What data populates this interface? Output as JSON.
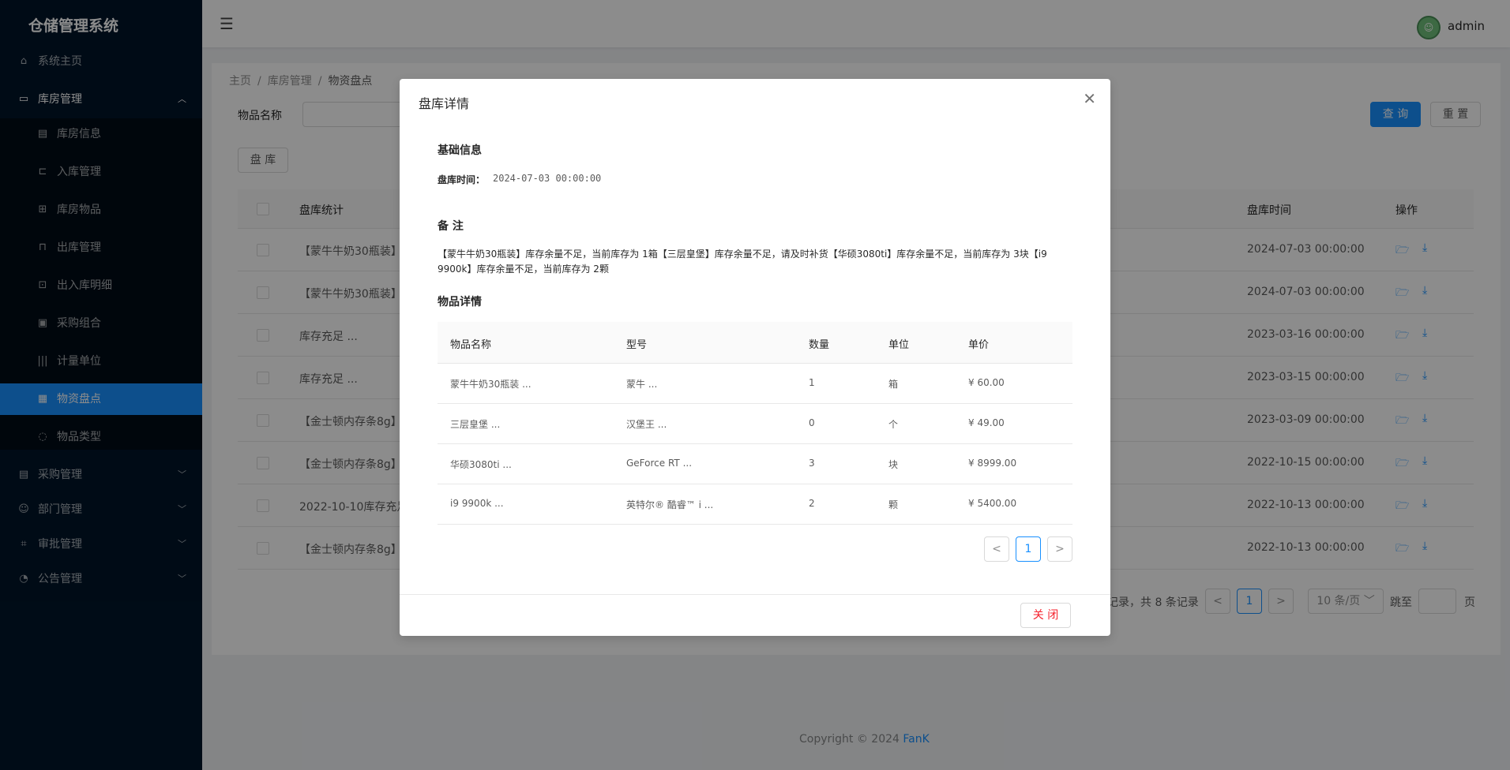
{
  "app": {
    "title": "仓储管理系统"
  },
  "sidebar": {
    "items": [
      {
        "label": "系统主页",
        "icon": "home-icon"
      },
      {
        "label": "库房管理",
        "icon": "warehouse-icon"
      },
      {
        "label": "库房信息",
        "icon": "info-icon"
      },
      {
        "label": "入库管理",
        "icon": "inbound-icon"
      },
      {
        "label": "库房物品",
        "icon": "table-icon"
      },
      {
        "label": "出库管理",
        "icon": "outbound-icon"
      },
      {
        "label": "出入库明细",
        "icon": "detail-icon"
      },
      {
        "label": "采购组合",
        "icon": "bundle-icon"
      },
      {
        "label": "计量单位",
        "icon": "barcode-icon"
      },
      {
        "label": "物资盘点",
        "icon": "inventory-icon"
      },
      {
        "label": "物品类型",
        "icon": "loading-icon"
      },
      {
        "label": "采购管理",
        "icon": "purchase-icon"
      },
      {
        "label": "部门管理",
        "icon": "user-icon"
      },
      {
        "label": "审批管理",
        "icon": "approval-icon"
      },
      {
        "label": "公告管理",
        "icon": "notice-icon"
      }
    ]
  },
  "header": {
    "username": "admin"
  },
  "breadcrumb": {
    "home": "主页",
    "section": "库房管理",
    "current": "物资盘点",
    "sep": "/"
  },
  "search": {
    "label": "物品名称",
    "query_label": "查 询",
    "reset_label": "重 置"
  },
  "toolbar": {
    "inventory_label": "盘 库"
  },
  "table": {
    "headers": {
      "stats": "盘库统计",
      "time": "盘库时间",
      "actions": "操作"
    },
    "rows": [
      {
        "stats": "【蒙牛牛奶30瓶装】",
        "time": "2024-07-03 00:00:00"
      },
      {
        "stats": "【蒙牛牛奶30瓶装】",
        "time": "2024-07-03 00:00:00"
      },
      {
        "stats": "库存充足 ...",
        "time": "2023-03-16 00:00:00"
      },
      {
        "stats": "库存充足 ...",
        "time": "2023-03-15 00:00:00"
      },
      {
        "stats": "【金士顿内存条8g】",
        "time": "2023-03-09 00:00:00"
      },
      {
        "stats": "【金士顿内存条8g】",
        "time": "2022-10-15 00:00:00"
      },
      {
        "stats": "2022-10-10库存充足",
        "time": "2022-10-13 00:00:00"
      },
      {
        "stats": "【金士顿内存条8g】",
        "time": "2022-10-13 00:00:00"
      }
    ]
  },
  "pagination": {
    "summary": "记录，共 8 条记录",
    "current": "1",
    "size": "10 条/页",
    "jump_label": "跳至",
    "page_suffix": "页",
    "prev": "<",
    "next": ">"
  },
  "footer": {
    "copyright": "Copyright © 2024",
    "author": "FanK"
  },
  "modal": {
    "title": "盘库详情",
    "basic_title": "基础信息",
    "time_label": "盘库时间：",
    "time_value": "2024-07-03 00:00:00",
    "remark_title": "备 注",
    "remark": "【蒙牛牛奶30瓶装】库存余量不足，当前库存为 1箱【三层皇堡】库存余量不足，请及时补货【华硕3080ti】库存余量不足，当前库存为 3块【i9 9900k】库存余量不足，当前库存为 2颗",
    "items_title": "物品详情",
    "item_headers": {
      "name": "物品名称",
      "model": "型号",
      "qty": "数量",
      "unit": "单位",
      "price": "单价"
    },
    "items": [
      {
        "name": "蒙牛牛奶30瓶装 ...",
        "model": "蒙牛 ...",
        "qty": "1",
        "unit": "箱",
        "price": "¥ 60.00"
      },
      {
        "name": "三层皇堡 ...",
        "model": "汉堡王 ...",
        "qty": "0",
        "unit": "个",
        "price": "¥ 49.00"
      },
      {
        "name": "华硕3080ti ...",
        "model": "GeForce RT ...",
        "qty": "3",
        "unit": "块",
        "price": "¥ 8999.00"
      },
      {
        "name": "i9 9900k ...",
        "model": "英特尔® 酷睿™ i ...",
        "qty": "2",
        "unit": "颗",
        "price": "¥ 5400.00"
      }
    ],
    "page": "1",
    "close_label": "关 闭"
  }
}
